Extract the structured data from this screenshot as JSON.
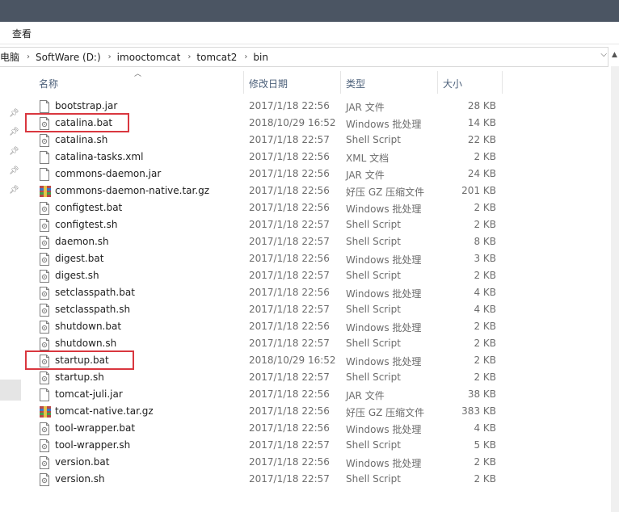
{
  "menu": {
    "view_label": "查看"
  },
  "address": {
    "crumbs": [
      "电脑",
      "SoftWare (D:)",
      "imooctomcat",
      "tomcat2",
      "bin"
    ],
    "sep": "›",
    "dropdown": "⌵"
  },
  "columns": {
    "name": "名称",
    "date": "修改日期",
    "type": "类型",
    "size": "大小"
  },
  "icons": {
    "pin": "pin-icon",
    "sort": "sort-up-icon"
  },
  "files": [
    {
      "name": "bootstrap.jar",
      "date": "2017/1/18 22:56",
      "type": "JAR 文件",
      "size": "28 KB",
      "icon": "file-icon"
    },
    {
      "name": "catalina.bat",
      "date": "2018/10/29 16:52",
      "type": "Windows 批处理",
      "size": "14 KB",
      "icon": "script-icon",
      "highlighted": true
    },
    {
      "name": "catalina.sh",
      "date": "2017/1/18 22:57",
      "type": "Shell Script",
      "size": "22 KB",
      "icon": "script-icon"
    },
    {
      "name": "catalina-tasks.xml",
      "date": "2017/1/18 22:56",
      "type": "XML 文档",
      "size": "2 KB",
      "icon": "file-icon"
    },
    {
      "name": "commons-daemon.jar",
      "date": "2017/1/18 22:56",
      "type": "JAR 文件",
      "size": "24 KB",
      "icon": "file-icon"
    },
    {
      "name": "commons-daemon-native.tar.gz",
      "date": "2017/1/18 22:56",
      "type": "好压 GZ 压缩文件",
      "size": "201 KB",
      "icon": "archive-icon"
    },
    {
      "name": "configtest.bat",
      "date": "2017/1/18 22:56",
      "type": "Windows 批处理",
      "size": "2 KB",
      "icon": "script-icon"
    },
    {
      "name": "configtest.sh",
      "date": "2017/1/18 22:57",
      "type": "Shell Script",
      "size": "2 KB",
      "icon": "script-icon"
    },
    {
      "name": "daemon.sh",
      "date": "2017/1/18 22:57",
      "type": "Shell Script",
      "size": "8 KB",
      "icon": "script-icon"
    },
    {
      "name": "digest.bat",
      "date": "2017/1/18 22:56",
      "type": "Windows 批处理",
      "size": "3 KB",
      "icon": "script-icon"
    },
    {
      "name": "digest.sh",
      "date": "2017/1/18 22:57",
      "type": "Shell Script",
      "size": "2 KB",
      "icon": "script-icon"
    },
    {
      "name": "setclasspath.bat",
      "date": "2017/1/18 22:56",
      "type": "Windows 批处理",
      "size": "4 KB",
      "icon": "script-icon"
    },
    {
      "name": "setclasspath.sh",
      "date": "2017/1/18 22:57",
      "type": "Shell Script",
      "size": "4 KB",
      "icon": "script-icon"
    },
    {
      "name": "shutdown.bat",
      "date": "2017/1/18 22:56",
      "type": "Windows 批处理",
      "size": "2 KB",
      "icon": "script-icon"
    },
    {
      "name": "shutdown.sh",
      "date": "2017/1/18 22:57",
      "type": "Shell Script",
      "size": "2 KB",
      "icon": "script-icon"
    },
    {
      "name": "startup.bat",
      "date": "2018/10/29 16:52",
      "type": "Windows 批处理",
      "size": "2 KB",
      "icon": "script-icon",
      "highlighted": true
    },
    {
      "name": "startup.sh",
      "date": "2017/1/18 22:57",
      "type": "Shell Script",
      "size": "2 KB",
      "icon": "script-icon"
    },
    {
      "name": "tomcat-juli.jar",
      "date": "2017/1/18 22:56",
      "type": "JAR 文件",
      "size": "38 KB",
      "icon": "file-icon"
    },
    {
      "name": "tomcat-native.tar.gz",
      "date": "2017/1/18 22:56",
      "type": "好压 GZ 压缩文件",
      "size": "383 KB",
      "icon": "archive-icon"
    },
    {
      "name": "tool-wrapper.bat",
      "date": "2017/1/18 22:56",
      "type": "Windows 批处理",
      "size": "4 KB",
      "icon": "script-icon"
    },
    {
      "name": "tool-wrapper.sh",
      "date": "2017/1/18 22:57",
      "type": "Shell Script",
      "size": "5 KB",
      "icon": "script-icon"
    },
    {
      "name": "version.bat",
      "date": "2017/1/18 22:56",
      "type": "Windows 批处理",
      "size": "2 KB",
      "icon": "script-icon"
    },
    {
      "name": "version.sh",
      "date": "2017/1/18 22:57",
      "type": "Shell Script",
      "size": "2 KB",
      "icon": "script-icon"
    }
  ],
  "colors": {
    "highlight": "#d9373f",
    "header_text": "#4c607a"
  }
}
